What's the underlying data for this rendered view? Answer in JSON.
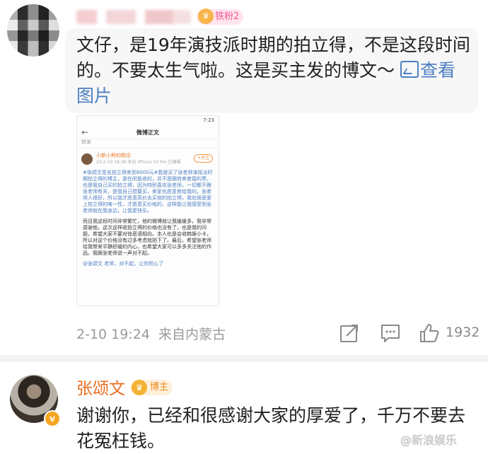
{
  "comment1": {
    "username": "",
    "badge": "铁粉2",
    "text": "文仔，是19年演技派时期的拍立得，不是这段时间的。不要太生气啦。这是买主发的博文～",
    "link_text": "查看图片",
    "timestamp": "2-10 19:24",
    "location": "来自内蒙古",
    "like_count": "1932",
    "icons": [
      "share-icon",
      "comment-icon",
      "like-icon"
    ],
    "screenshot": {
      "status_time": "7:23",
      "title": "微博正文",
      "sub": "转发",
      "user_name": "小新小熊的税论",
      "user_meta": "20-2-10 18:38 来自 iPhone 10 Pro 已编辑",
      "follow_label": "+关注",
      "paragraphs": [
        "#张颂文签名拍立得卖到8000元#我是买了张老师演技派时期拍立得的博主，是在闲鱼收的，并不是跟转卖者接的票，也是我自己买的拍立得，因为特别喜欢张老师，一切都不跟张老师有关，是我自己想要买，卖家也愿意卖给我的。张老师人很好，所以我才愿意高价去买他的拍立得，我也很是爱上拍立得的唯一性，才愿意买价格的。这样能让我感受到张老师就在我身边，让我更快乐。",
        "而且我这段时间非常繁忙，他的微博就让我缓缓多，我非常感谢他。这次这样收拍立得的价格也没有了，也是我的问题，希望大家不要对他恶语相向。本人也是会收韩娱小卡，所以对这个价格没有过多考虑就拍下了。最后，希望张老师给我带来平静舒缓的内心，也希望大家可以多多关注他的作品。我跟张老师说一声对不起。",
        "@张颂文 老师，对不起，让你担心了"
      ]
    }
  },
  "comment2": {
    "username": "张颂文",
    "badge": "博主",
    "text": "谢谢你，已经和很感谢大家的厚爱了，千万不要去花冤枉钱。"
  },
  "watermark": "新浪娱乐"
}
